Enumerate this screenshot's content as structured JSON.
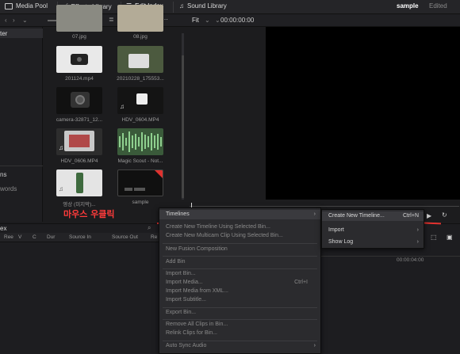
{
  "topbar": {
    "media_pool": "Media Pool",
    "effects_library": "Effects Library",
    "edit_index": "Edit Index",
    "sound_library": "Sound Library",
    "project_name": "sample",
    "project_status": "Edited"
  },
  "viewer_bar": {
    "fit_label": "Fit",
    "timecode": "00:00:00:00"
  },
  "bins": {
    "items": [
      "ter",
      "ns",
      "words"
    ]
  },
  "clips": [
    {
      "label": "07.jpg"
    },
    {
      "label": "08.jpg"
    },
    {
      "label": "201124.mp4"
    },
    {
      "label": "20210228_175553..."
    },
    {
      "label": "camera-32871_12..."
    },
    {
      "label": "HDV_0604.MP4"
    },
    {
      "label": "HDV_0606.MP4"
    },
    {
      "label": "Magic Scout - Not..."
    },
    {
      "label": "영상 (미지막)..."
    },
    {
      "label": "sample"
    }
  ],
  "annotation": "마우스 우클릭",
  "lower_panel": {
    "title": "ex",
    "columns": [
      "Ree",
      "V",
      "C",
      "Dur",
      "Source In",
      "Source Out",
      "Re"
    ],
    "timeline_tc": "00:00:04:00"
  },
  "context_menu": {
    "items": [
      {
        "label": "Timelines",
        "enabled": true,
        "submenu": true
      },
      {
        "label": "Create New Timeline Using Selected Bin...",
        "enabled": false
      },
      {
        "label": "Create New Multicam Clip Using Selected Bin...",
        "enabled": false
      },
      {
        "label": "New Fusion Composition",
        "enabled": false
      },
      {
        "label": "Add Bin",
        "enabled": false
      },
      {
        "label": "Import Bin...",
        "enabled": false
      },
      {
        "label": "Import Media...",
        "enabled": false,
        "shortcut": "Ctrl+I"
      },
      {
        "label": "Import Media from XML...",
        "enabled": false
      },
      {
        "label": "Import Subtitle...",
        "enabled": false
      },
      {
        "label": "Export Bin...",
        "enabled": false
      },
      {
        "label": "Remove All Clips in Bin...",
        "enabled": false
      },
      {
        "label": "Relink Clips for Bin...",
        "enabled": false
      },
      {
        "label": "Auto Sync Audio",
        "enabled": false,
        "submenu": true
      }
    ]
  },
  "submenu": {
    "items": [
      {
        "label": "Create New Timeline...",
        "shortcut": "Ctrl+N"
      },
      {
        "label": "Import",
        "submenu": true
      },
      {
        "label": "Show Log",
        "submenu": true
      }
    ]
  },
  "colors": {
    "accent": "#e0322f",
    "annotation": "#ff3b3b"
  }
}
